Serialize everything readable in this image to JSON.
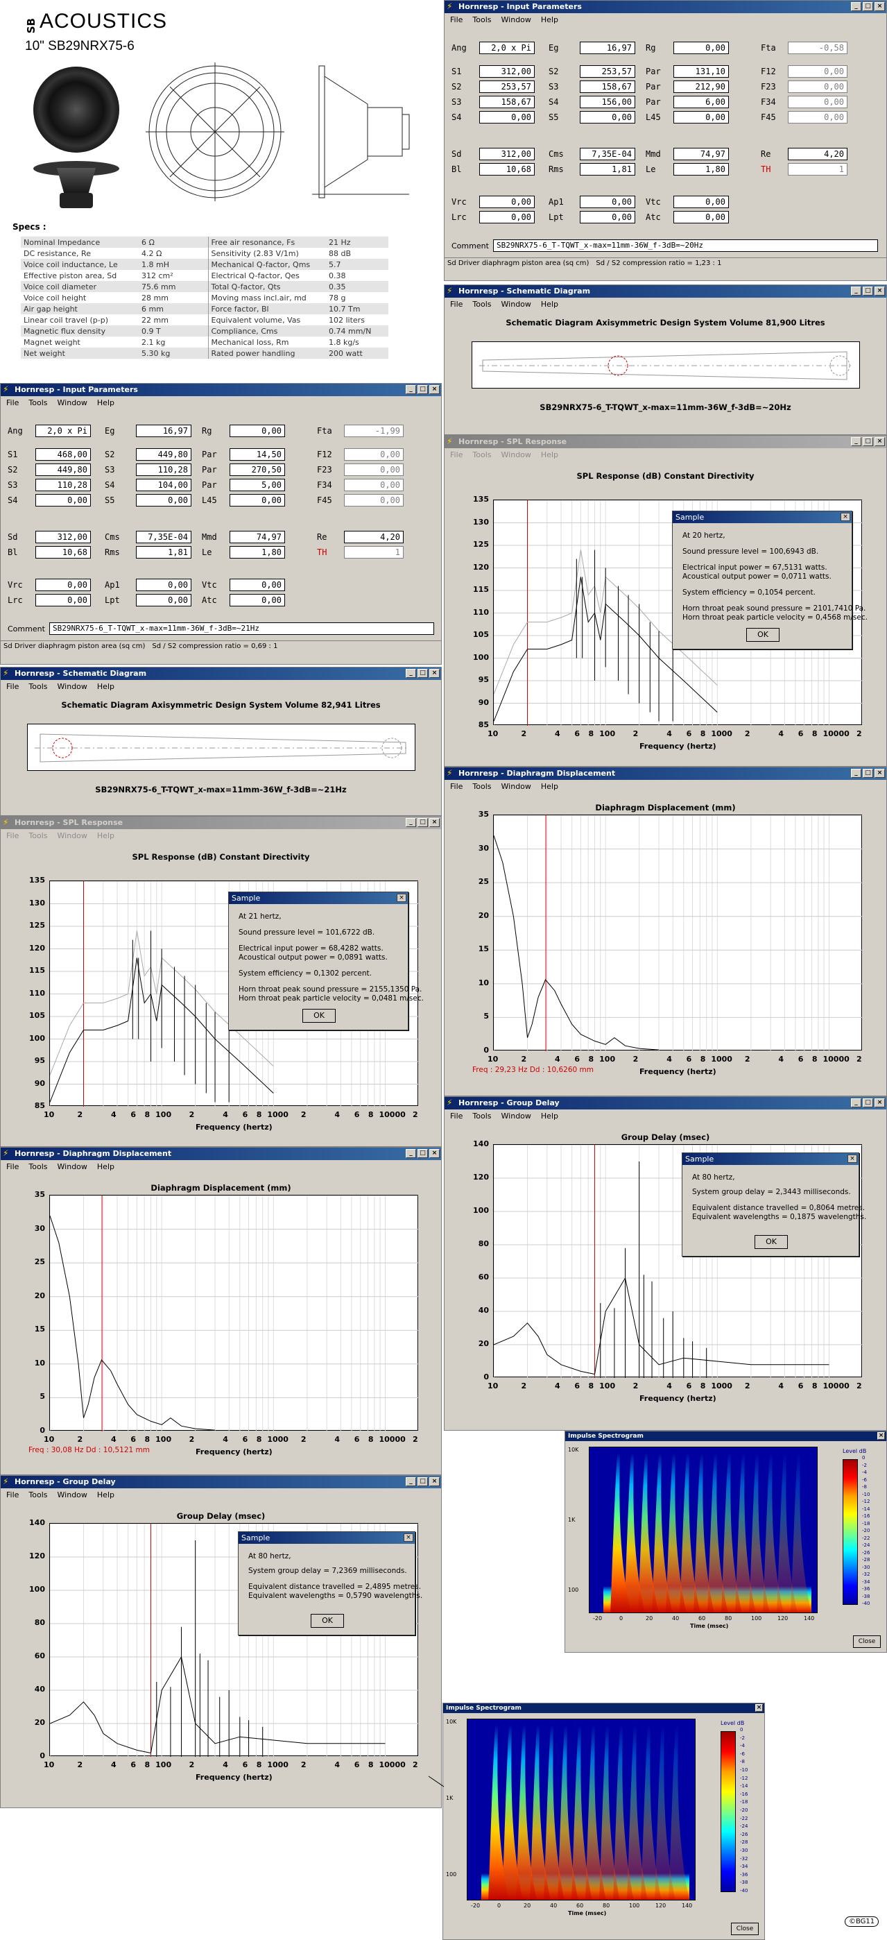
{
  "datasheet": {
    "brand": "ACOUSTICS",
    "brand_prefix": "SB",
    "model": "10\" SB29NRX75-6",
    "specs_title": "Specs :",
    "specs_left": [
      [
        "Nominal Impedance",
        "6 Ω"
      ],
      [
        "DC resistance, Re",
        "4.2 Ω"
      ],
      [
        "Voice coil inductance, Le",
        "1.8 mH"
      ],
      [
        "Effective piston area, Sd",
        "312 cm²"
      ],
      [
        "Voice coil diameter",
        "75.6 mm"
      ],
      [
        "Voice coil height",
        "28 mm"
      ],
      [
        "Air gap height",
        "6 mm"
      ],
      [
        "Linear coil travel (p-p)",
        "22 mm"
      ],
      [
        "Magnetic flux density",
        "0.9 T"
      ],
      [
        "Magnet weight",
        "2.1 kg"
      ],
      [
        "Net weight",
        "5.30 kg"
      ]
    ],
    "specs_right": [
      [
        "Free air resonance, Fs",
        "21 Hz"
      ],
      [
        "Sensitivity (2.83 V/1m)",
        "88 dB"
      ],
      [
        "Mechanical Q-factor, Qms",
        "5.7"
      ],
      [
        "Electrical Q-factor, Qes",
        "0.38"
      ],
      [
        "Total Q-factor, Qts",
        "0.35"
      ],
      [
        "Moving mass incl.air, md",
        "78 g"
      ],
      [
        "Force factor, Bl",
        "10.7 Tm"
      ],
      [
        "Equivalent volume, Vas",
        "102 liters"
      ],
      [
        "Compliance, Cms",
        "0.74 mm/N"
      ],
      [
        "Mechanical loss, Rm",
        "1.8 kg/s"
      ],
      [
        "Rated power handling",
        "200 watt"
      ]
    ]
  },
  "menus": {
    "main": [
      "File",
      "Tools",
      "Window",
      "Help"
    ],
    "graph": [
      "File",
      "Tools",
      "Window",
      "Help"
    ]
  },
  "labels": {
    "ang": "Ang",
    "eg": "Eg",
    "rg": "Rg",
    "fta": "Fta",
    "s1": "S1",
    "s2": "S2",
    "s3": "S3",
    "s4": "S4",
    "s5": "S5",
    "par": "Par",
    "f12": "F12",
    "f23": "F23",
    "f34": "F34",
    "f45": "F45",
    "l45": "L45",
    "sd": "Sd",
    "bl": "Bl",
    "cms": "Cms",
    "rms": "Rms",
    "mmd": "Mmd",
    "le": "Le",
    "re": "Re",
    "th": "TH",
    "vrc": "Vrc",
    "lrc": "Lrc",
    "ap1": "Ap1",
    "lpt": "Lpt",
    "vtc": "Vtc",
    "atc": "Atc",
    "comment": "Comment"
  },
  "titles": {
    "input": "Hornresp - Input Parameters",
    "schematic": "Hornresp - Schematic Diagram",
    "spl": "Hornresp - SPL Response",
    "disp": "Hornresp - Diaphragm Displacement",
    "gd": "Hornresp - Group Delay",
    "impulse": "Impulse Spectrogram",
    "sample": "Sample",
    "ok": "OK",
    "close": "Close"
  },
  "input_a": {
    "ang": "2,0 x Pi",
    "eg": "16,97",
    "rg": "0,00",
    "fta": "-0,58",
    "s1": "312,00",
    "s2": "253,57",
    "s3": "158,67",
    "s4": "0,00",
    "l12": "253,57",
    "l23": "158,67",
    "l34": "156,00",
    "s5": "0,00",
    "par12": "131,10",
    "par23": "212,90",
    "par34": "6,00",
    "l45": "0,00",
    "f12": "0,00",
    "f23": "0,00",
    "f34": "0,00",
    "f45": "0,00",
    "sd": "312,00",
    "bl": "10,68",
    "cms": "7,35E-04",
    "rms": "1,81",
    "mmd": "74,97",
    "le": "1,80",
    "re": "4,20",
    "th": "1",
    "vrc": "0,00",
    "lrc": "0,00",
    "ap1": "0,00",
    "lpt": "0,00",
    "vtc": "0,00",
    "atc": "0,00",
    "comment": "SB29NRX75-6_T-TQWT_x-max=11mm-36W_f-3dB=~20Hz",
    "status1": "Sd  Driver diaphragm piston area (sq cm)",
    "status2": "Sd / S2 compression ratio = 1,23 : 1"
  },
  "input_b": {
    "ang": "2,0 x Pi",
    "eg": "16,97",
    "rg": "0,00",
    "fta": "-1,99",
    "s1": "468,00",
    "s2": "449,80",
    "s3": "110,28",
    "s4": "0,00",
    "l12": "449,80",
    "l23": "110,28",
    "l34": "104,00",
    "s5": "0,00",
    "par12": "14,50",
    "par23": "270,50",
    "par34": "5,00",
    "l45": "0,00",
    "f12": "0,00",
    "f23": "0,00",
    "f34": "0,00",
    "f45": "0,00",
    "sd": "312,00",
    "bl": "10,68",
    "cms": "7,35E-04",
    "rms": "1,81",
    "mmd": "74,97",
    "le": "1,80",
    "re": "4,20",
    "th": "1",
    "vrc": "0,00",
    "lrc": "0,00",
    "ap1": "0,00",
    "lpt": "0,00",
    "vtc": "0,00",
    "atc": "0,00",
    "comment": "SB29NRX75-6_T-TQWT_x-max=11mm-36W_f-3dB=~21Hz",
    "status1": "Sd  Driver diaphragm piston area (sq cm)",
    "status2": "Sd / S2 compression ratio = 0,69 : 1"
  },
  "schem_a": {
    "head": "Schematic Diagram   Axisymmetric Design   System Volume 81,900 Litres",
    "caption": "SB29NRX75-6_T-TQWT_x-max=11mm-36W_f-3dB=~20Hz"
  },
  "schem_b": {
    "head": "Schematic Diagram   Axisymmetric Design   System Volume 82,941 Litres",
    "caption": "SB29NRX75-6_T-TQWT_x-max=11mm-36W_f-3dB=~21Hz"
  },
  "spl_a": {
    "head": "SPL Response (dB)   Constant Directivity",
    "xlabel": "Frequency (hertz)",
    "dialog": [
      "At 20 hertz,",
      "Sound pressure level = 100,6943 dB.",
      "Electrical input power = 67,5131 watts.",
      "Acoustical output power = 0,0711 watts.",
      "System efficiency = 0,1054 percent.",
      "Horn throat peak sound pressure = 2101,7410 Pa.",
      "Horn throat peak particle velocity = 0,4568 m/sec."
    ]
  },
  "spl_b": {
    "head": "SPL Response (dB)   Constant Directivity",
    "xlabel": "Frequency (hertz)",
    "dialog": [
      "At 21 hertz,",
      "Sound pressure level = 101,6722 dB.",
      "Electrical input power = 68,4282 watts.",
      "Acoustical output power = 0,0891 watts.",
      "System efficiency = 0,1302 percent.",
      "Horn throat peak sound pressure = 2155,1350 Pa.",
      "Horn throat peak particle velocity = 0,0481 m/sec."
    ]
  },
  "disp_a": {
    "head": "Diaphragm Displacement (mm)",
    "xlabel": "Frequency (hertz)",
    "readout": "Freq : 29,23 Hz    Dd : 10,6260 mm"
  },
  "disp_b": {
    "head": "Diaphragm Displacement (mm)",
    "xlabel": "Frequency (hertz)",
    "readout": "Freq : 30,08 Hz    Dd : 10,5121 mm"
  },
  "gd_a": {
    "head": "Group Delay (msec)",
    "xlabel": "Frequency (hertz)",
    "dialog": [
      "At 80 hertz,",
      "System group delay = 2,3443 milliseconds.",
      "Equivalent distance travelled = 0,8064 metres.",
      "Equivalent wavelengths = 0,1875 wavelengths."
    ]
  },
  "gd_b": {
    "head": "Group Delay (msec)",
    "xlabel": "Frequency (hertz)",
    "dialog": [
      "At 80 hertz,",
      "System group delay = 7,2369 milliseconds.",
      "Equivalent distance travelled = 2,4895 metres.",
      "Equivalent wavelengths = 0,5790 wavelengths."
    ]
  },
  "spectro": {
    "xlabel": "Time (msec)",
    "level": "Level   dB",
    "xticks": [
      "-20",
      "0",
      "20",
      "40",
      "60",
      "80",
      "100",
      "120",
      "140"
    ],
    "yticks": [
      "10K",
      "1K",
      "100"
    ],
    "scale": [
      "0",
      "-2",
      "-4",
      "-6",
      "-8",
      "-10",
      "-12",
      "-14",
      "-16",
      "-18",
      "-20",
      "-22",
      "-24",
      "-26",
      "-28",
      "-30",
      "-32",
      "-34",
      "-36",
      "-38",
      "-40"
    ]
  },
  "axes": {
    "freq_ticks": [
      "10",
      "2",
      "4",
      "6",
      "8",
      "100",
      "2",
      "4",
      "6",
      "8",
      "1000",
      "2",
      "4",
      "6",
      "8",
      "10000",
      "2"
    ],
    "spl_y": [
      "135",
      "130",
      "125",
      "120",
      "115",
      "110",
      "105",
      "100",
      "95",
      "90",
      "85"
    ],
    "disp_y": [
      "35",
      "30",
      "25",
      "20",
      "15",
      "10",
      "5",
      "0"
    ],
    "gd_y": [
      "140",
      "120",
      "100",
      "80",
      "60",
      "40",
      "20",
      "0"
    ]
  },
  "signature": "©BG11",
  "chart_data": [
    {
      "type": "line",
      "title": "SPL Response (dB)   Constant Directivity",
      "xlabel": "Frequency (hertz)",
      "xscale": "log",
      "xlim": [
        10,
        20000
      ],
      "ylim": [
        85,
        135
      ],
      "marker_hz": 20,
      "series": [
        {
          "x": [
            10,
            15,
            20,
            25,
            30,
            40,
            50,
            60,
            70,
            80,
            90,
            100,
            150,
            200,
            300,
            500,
            1000
          ],
          "values": [
            86,
            97,
            102,
            102,
            102,
            103,
            104,
            118,
            108,
            110,
            104,
            112,
            108,
            105,
            100,
            95,
            88
          ]
        }
      ]
    },
    {
      "type": "line",
      "title": "Diaphragm Displacement (mm)",
      "xlabel": "Frequency (hertz)",
      "xscale": "log",
      "xlim": [
        10,
        20000
      ],
      "ylim": [
        0,
        35
      ],
      "marker_hz": 29.23,
      "series": [
        {
          "x": [
            10,
            12,
            15,
            18,
            20,
            22,
            25,
            29,
            35,
            40,
            50,
            60,
            80,
            100,
            120,
            150,
            200,
            300
          ],
          "values": [
            32,
            28,
            20,
            10,
            2,
            4,
            8,
            10.6,
            9,
            7,
            4,
            2.5,
            1.5,
            1,
            2,
            0.8,
            0.4,
            0.2
          ]
        }
      ]
    },
    {
      "type": "line",
      "title": "Group Delay (msec)",
      "xlabel": "Frequency (hertz)",
      "xscale": "log",
      "xlim": [
        10,
        20000
      ],
      "ylim": [
        0,
        140
      ],
      "marker_hz": 80,
      "series": [
        {
          "x": [
            10,
            15,
            20,
            25,
            30,
            40,
            60,
            80,
            100,
            150,
            200,
            300,
            500,
            1000,
            2000,
            10000
          ],
          "values": [
            20,
            25,
            33,
            25,
            14,
            8,
            4,
            2.3,
            40,
            60,
            20,
            8,
            12,
            10,
            8,
            8
          ]
        }
      ]
    }
  ]
}
